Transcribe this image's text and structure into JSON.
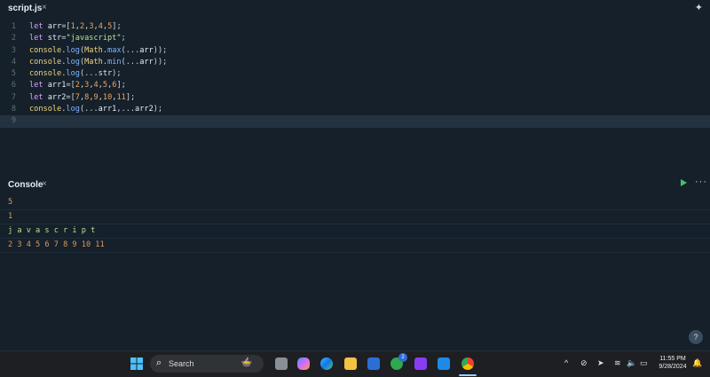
{
  "editor": {
    "tab_title": "script.js",
    "close_symbol": "×",
    "line_numbers": [
      "1",
      "2",
      "3",
      "4",
      "5",
      "6",
      "7",
      "8",
      "9"
    ],
    "lines": [
      "let arr=[1,2,3,4,5];",
      "let str=\"javascript\";",
      "console.log(Math.max(...arr));",
      "console.log(Math.min(...arr));",
      "console.log(...str);",
      "let arr1=[2,3,4,5,6];",
      "let arr2=[7,8,9,10,11];",
      "console.log(...arr1,...arr2);",
      ""
    ],
    "active_line": 9
  },
  "console": {
    "title": "Console",
    "close_symbol": "×",
    "more_symbol": "···",
    "outputs": [
      "5",
      "1",
      "j a v a s c r i p t",
      "2 3 4 5 6 7 8 9 10 11"
    ]
  },
  "help": {
    "symbol": "?"
  },
  "taskbar": {
    "search_placeholder": "Search",
    "xbox_badge": "2",
    "time": "11:55 PM",
    "date": "9/28/2024"
  },
  "colors": {
    "background": "#15202b",
    "keyword": "#d8a4ff",
    "number": "#f0a45d",
    "string": "#b8e08a",
    "function": "#7fb4ff",
    "run": "#3fc46a"
  }
}
